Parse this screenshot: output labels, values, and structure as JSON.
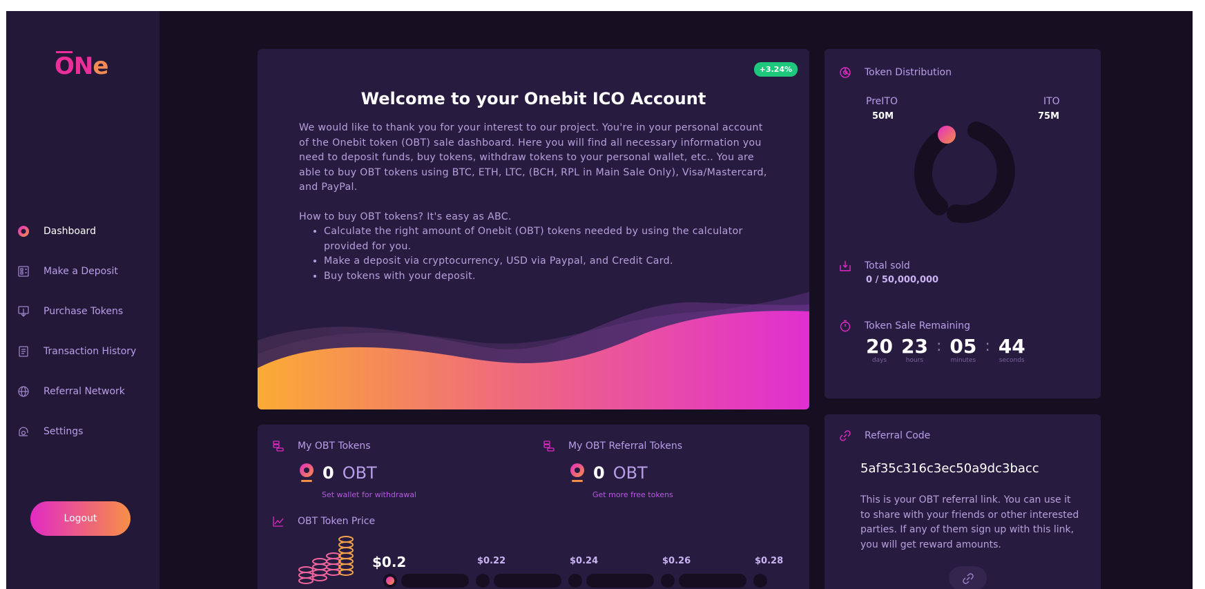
{
  "brand": {
    "logo": "ŌNe",
    "logo_o": "O",
    "logo_n": "N",
    "logo_e": "e"
  },
  "sidebar": {
    "items": [
      {
        "label": "Dashboard",
        "icon": "dashboard-icon",
        "active": true
      },
      {
        "label": "Make a Deposit",
        "icon": "deposit-icon"
      },
      {
        "label": "Purchase Tokens",
        "icon": "purchase-icon"
      },
      {
        "label": "Transaction History",
        "icon": "history-icon"
      },
      {
        "label": "Referral Network",
        "icon": "globe-icon"
      },
      {
        "label": "Settings",
        "icon": "settings-icon"
      }
    ],
    "logout_label": "Logout"
  },
  "welcome": {
    "badge": "+3.24%",
    "title": "Welcome to your Onebit ICO Account",
    "intro": "We would like to thank you for your interest to our project. You're in your personal account of the Onebit token (OBT) sale dashboard. Here you will find all necessary information you need to deposit funds, buy tokens, withdraw tokens to your personal wallet, etc.. You are able to buy OBT tokens using BTC, ETH, LTC, (BCH, RPL in Main Sale Only), Visa/Mastercard, and PayPal.",
    "howto_title": "How to buy OBT tokens? It's easy as ABC.",
    "steps": [
      "Calculate the right amount of Onebit (OBT) tokens needed by using the calculator provided for you.",
      "Make a deposit via cryptocurrency, USD via Paypal, and Credit Card.",
      "Buy tokens with your deposit."
    ]
  },
  "distribution": {
    "title": "Token Distribution",
    "preito_label": "PreITO",
    "preito_value": "50M",
    "ito_label": "ITO",
    "ito_value": "75M",
    "total_sold_label": "Total sold",
    "total_sold_value": "0 / 50,000,000",
    "remaining_label": "Token Sale Remaining",
    "countdown": {
      "days": "20",
      "days_label": "days",
      "hours": "23",
      "hours_label": "hours",
      "minutes": "05",
      "minutes_label": "minutes",
      "seconds": "44",
      "seconds_label": "seconds",
      "sep": ":"
    }
  },
  "tokens": {
    "my_title": "My OBT Tokens",
    "my_amount": "0",
    "my_unit": "OBT",
    "my_link": "Set wallet for withdrawal",
    "ref_title": "My OBT Referral Tokens",
    "ref_amount": "0",
    "ref_unit": "OBT",
    "ref_link": "Get more free tokens",
    "price_title": "OBT Token Price",
    "price_current": "$0.2",
    "price_steps": [
      "$0.22",
      "$0.24",
      "$0.26",
      "$0.28"
    ]
  },
  "referral": {
    "title": "Referral Code",
    "code": "5af35c316c3ec50a9dc3bacc",
    "text": "This is your OBT referral link. You can use it to share with your friends or other interested parties. If any of them sign up with this link, you will get reward amounts."
  },
  "colors": {
    "accent_pink": "#e12bc4",
    "accent_orange": "#f78f46",
    "badge_green": "#1fc77d",
    "card": "#281b40",
    "sidebar": "#231838"
  }
}
